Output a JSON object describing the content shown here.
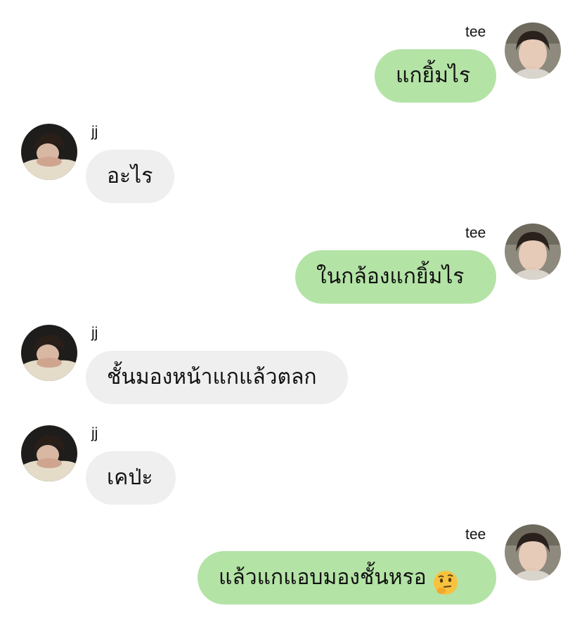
{
  "chat": {
    "messages": [
      {
        "sender": "tee",
        "text": "แกยิ้มไร"
      },
      {
        "sender": "jj",
        "text": "อะไร"
      },
      {
        "sender": "tee",
        "text": "ในกล้องแกยิ้มไร"
      },
      {
        "sender": "jj",
        "text": "ชั้นมองหน้าแกแล้วตลก"
      },
      {
        "sender": "jj",
        "text": "เคป่ะ"
      },
      {
        "sender": "tee",
        "text": "แล้วแกแอบมองชั้นหรอ",
        "emoji": "thinking-face"
      }
    ]
  },
  "colors": {
    "outgoing_bubble": "#b4e3a6",
    "incoming_bubble": "#efefef"
  }
}
